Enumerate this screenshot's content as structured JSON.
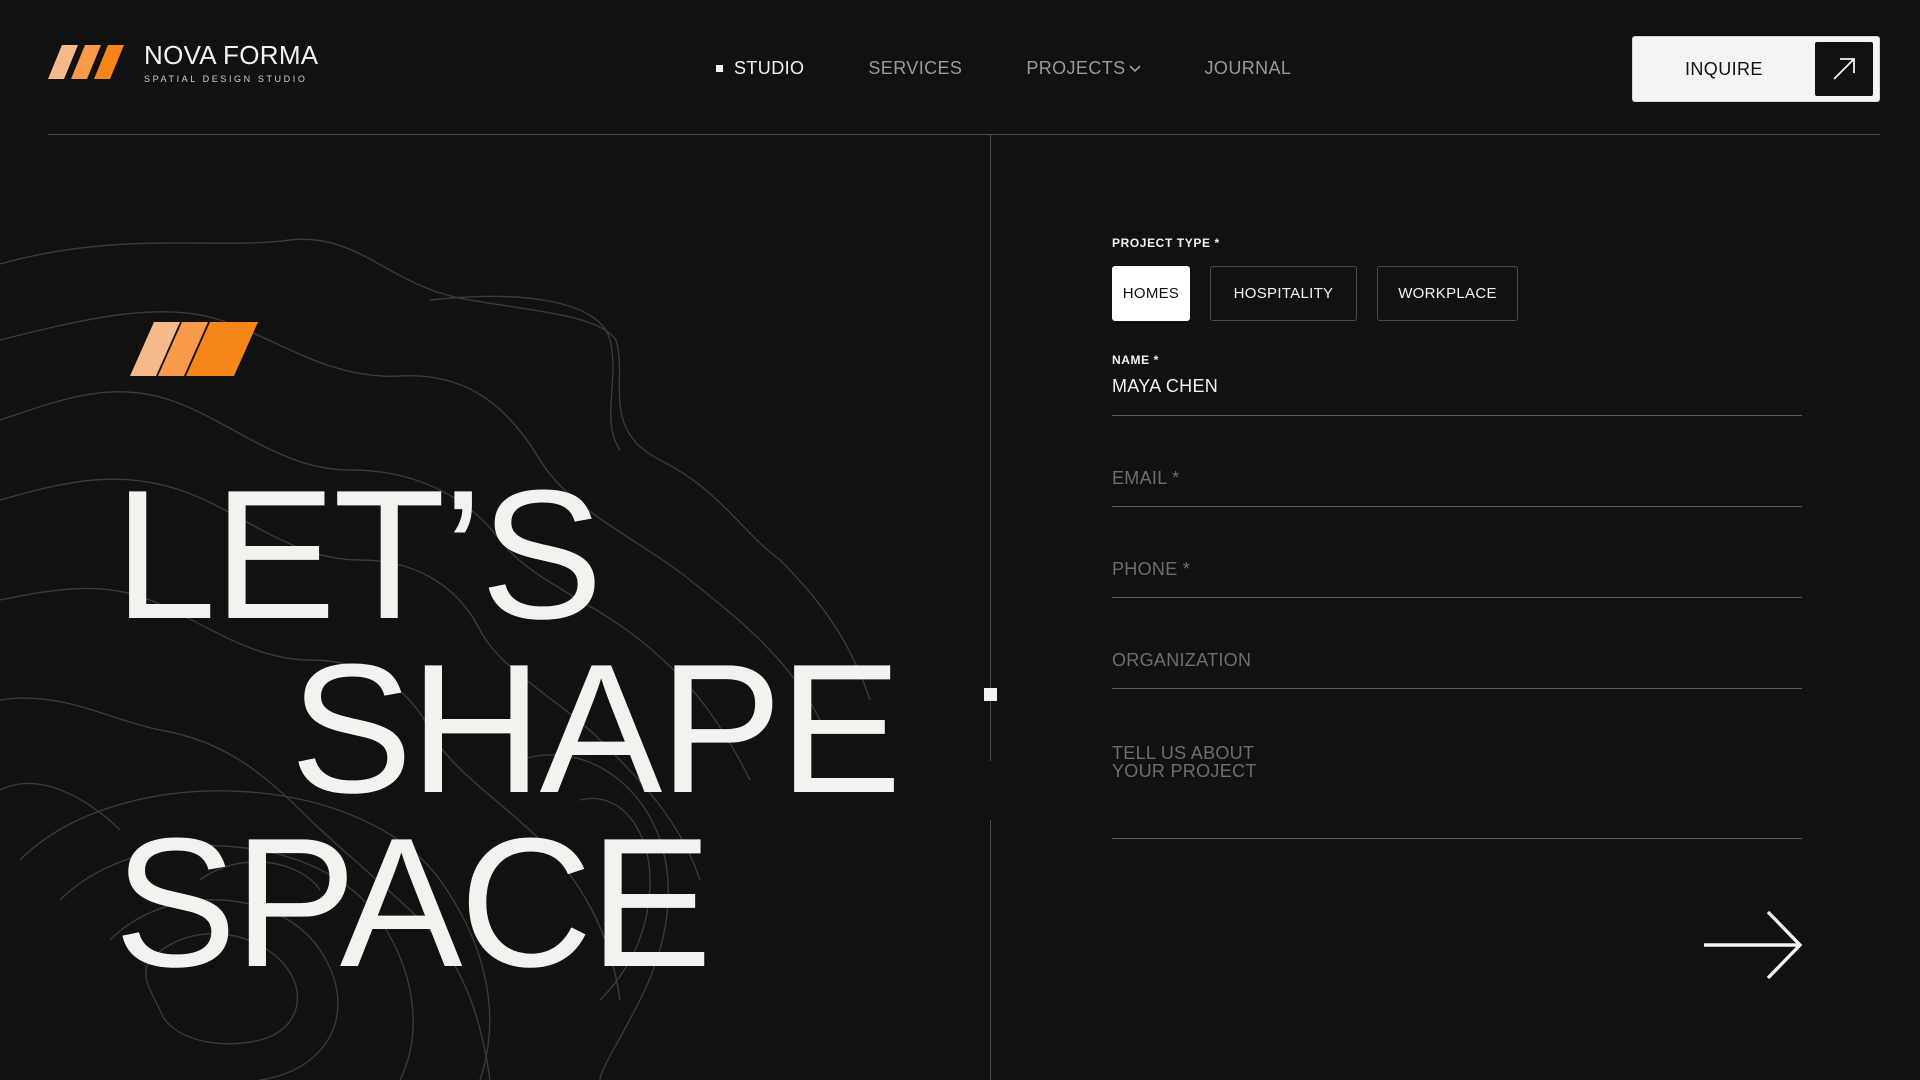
{
  "brand": {
    "name": "NOVA FORMA",
    "tagline": "SPATIAL DESIGN STUDIO",
    "accent_colors": [
      "#f4b07a",
      "#f79843",
      "#f6851a"
    ]
  },
  "nav": {
    "items": [
      {
        "label": "STUDIO",
        "active": true
      },
      {
        "label": "SERVICES",
        "active": false
      },
      {
        "label": "PROJECTS",
        "active": false,
        "has_dropdown": true
      },
      {
        "label": "JOURNAL",
        "active": false
      }
    ]
  },
  "cta": {
    "label": "INQUIRE",
    "icon": "arrow-up-right-icon"
  },
  "hero": {
    "lines": [
      "LET’S",
      "SHAPE",
      "SPACE"
    ]
  },
  "form": {
    "project_type_label": "PROJECT TYPE *",
    "project_types": [
      {
        "label": "HOMES",
        "selected": true
      },
      {
        "label": "HOSPITALITY",
        "selected": false
      },
      {
        "label": "WORKPLACE",
        "selected": false
      }
    ],
    "name_label": "NAME *",
    "name_value": "MAYA CHEN",
    "email_placeholder": "EMAIL *",
    "phone_placeholder": "PHONE *",
    "organization_placeholder": "ORGANIZATION",
    "message_placeholder": "TELL US ABOUT YOUR PROJECT",
    "submit_icon": "arrow-right-icon"
  },
  "colors": {
    "background": "#111111",
    "foreground": "#f2f2ef",
    "muted": "#9a9a96",
    "accent": "#f6851a"
  }
}
